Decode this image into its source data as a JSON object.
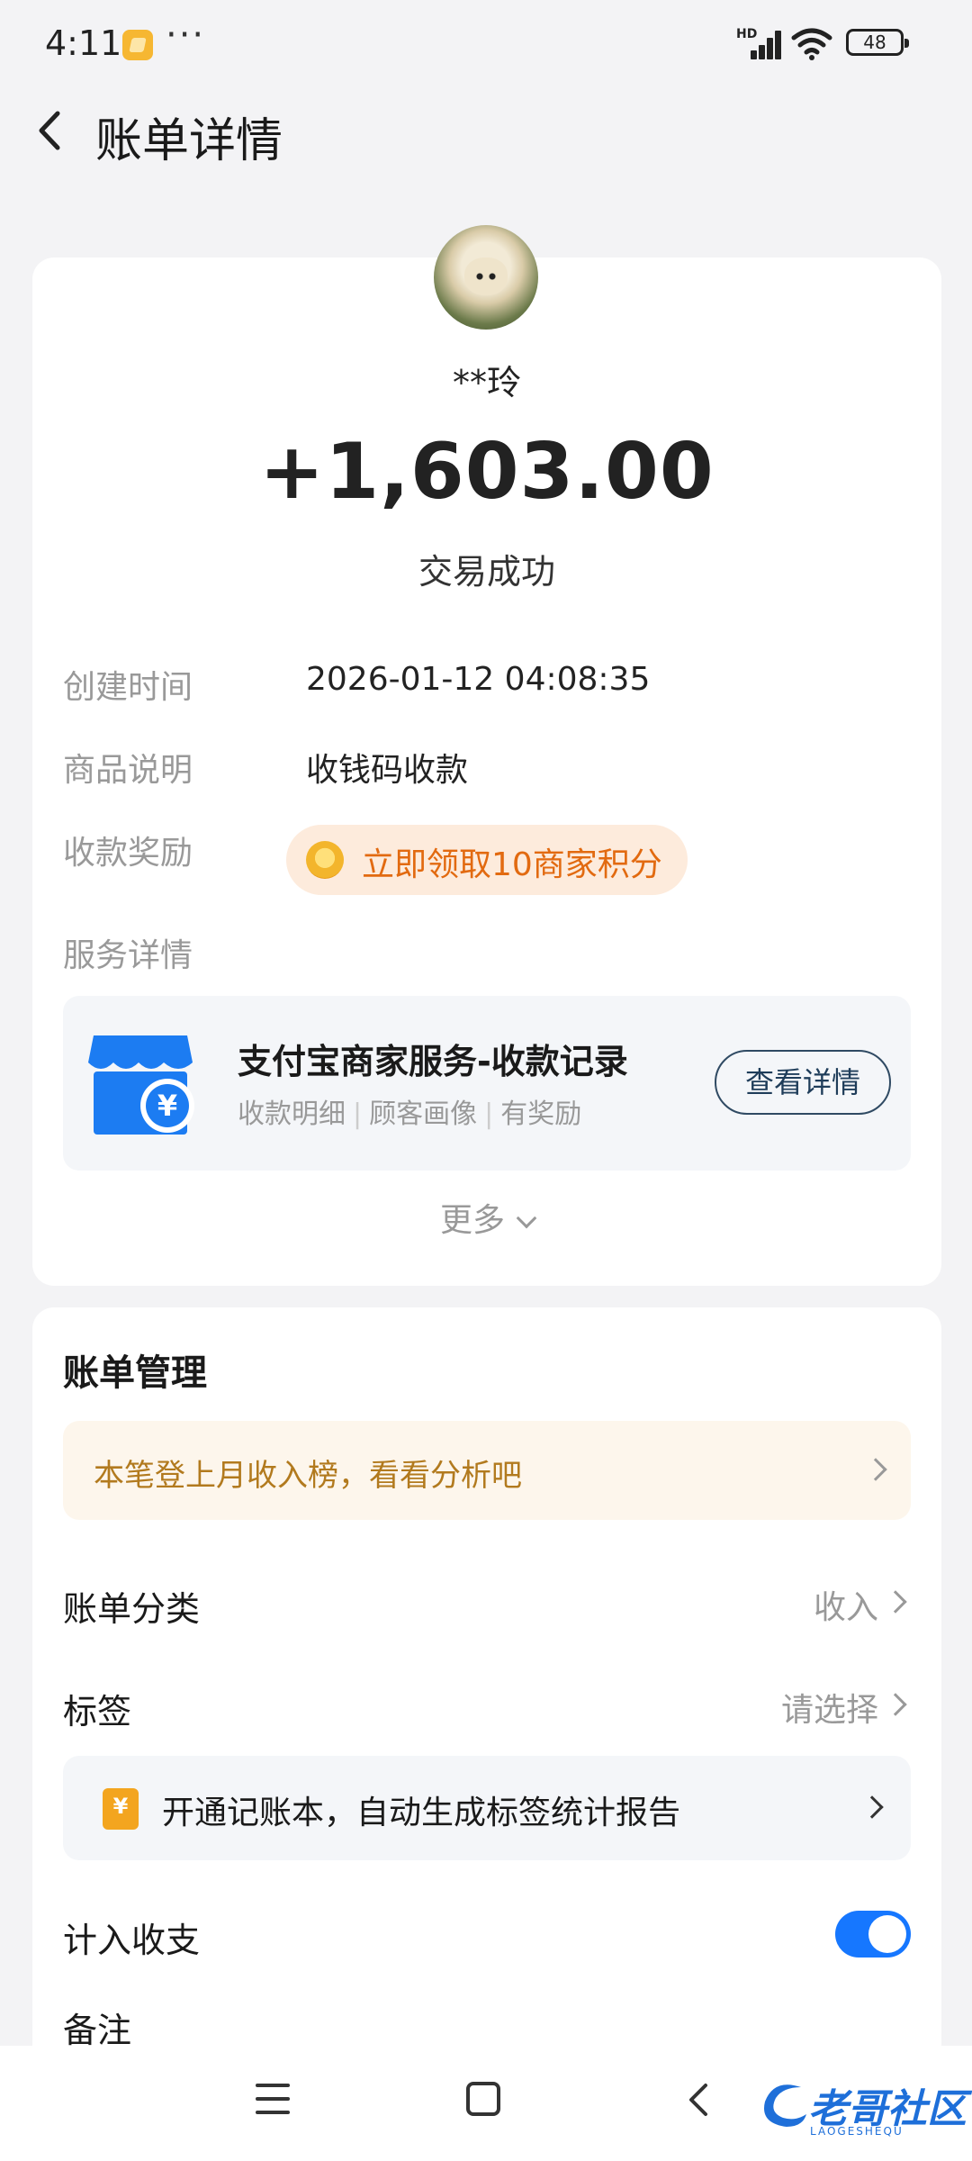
{
  "status_bar": {
    "time": "4:11",
    "dots": "···",
    "network": "HD",
    "battery": "48"
  },
  "header": {
    "title": "账单详情"
  },
  "transaction": {
    "payer": "**玲",
    "amount": "+1,603.00",
    "status": "交易成功",
    "details": [
      {
        "label": "创建时间",
        "value": "2026-01-12 04:08:35"
      },
      {
        "label": "商品说明",
        "value": "收钱码收款"
      }
    ],
    "reward_label": "收款奖励",
    "reward_text": "立即领取10商家积分",
    "service_label": "服务详情",
    "service": {
      "title": "支付宝商家服务-收款记录",
      "sub_items": [
        "收款明细",
        "顾客画像",
        "有奖励"
      ],
      "button": "查看详情"
    },
    "more": "更多"
  },
  "bill_management": {
    "title": "账单管理",
    "analysis_banner": "本笔登上月收入榜，看看分析吧",
    "category_label": "账单分类",
    "category_value": "收入",
    "tag_label": "标签",
    "tag_value": "请选择",
    "ledger_banner": "开通记账本，自动生成标签统计报告",
    "ledger_icon_symbol": "¥",
    "include_label": "计入收支",
    "include_enabled": true,
    "note_label": "备注"
  },
  "watermark": {
    "text": "老哥社区",
    "sub": "LAOGESHEQU"
  },
  "colors": {
    "accent_blue": "#1677ff",
    "reward_orange": "#e26a10",
    "banner_gold": "#b27a1e",
    "shop_blue": "#1c7cf2"
  }
}
